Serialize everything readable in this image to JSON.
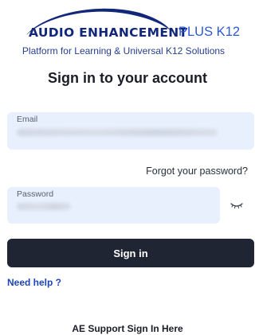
{
  "logo": {
    "brand": "AUDIO ENHANCEMENT",
    "plus": "PLUS K12",
    "tagline": "Platform for Learning & Universal K12 Solutions"
  },
  "title": "Sign in to your account",
  "email": {
    "label": "Email"
  },
  "forgot_password": "Forgot your password?",
  "password": {
    "label": "Password"
  },
  "icons": {
    "password_toggle": "eye-closed-icon",
    "logo_mark": "swoosh-logo-icon"
  },
  "sign_in_button": "Sign in",
  "need_help": "Need help ?",
  "support_sign_in": "AE Support Sign In Here",
  "colors": {
    "brand_navy": "#13277a",
    "accent_blue": "#2b58d8",
    "button_dark": "#1f2532",
    "field_bg": "#e8f0fe",
    "link_blue": "#1f46b9"
  }
}
